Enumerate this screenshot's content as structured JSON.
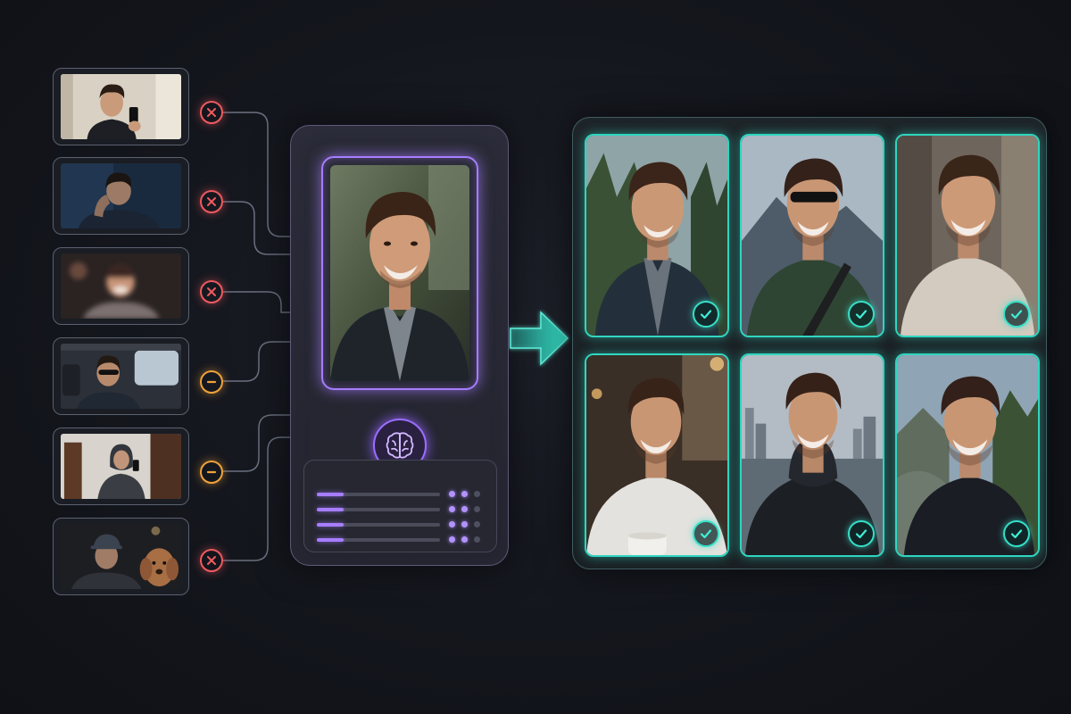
{
  "inputs": [
    {
      "scene": "mirror-selfie-indoor",
      "status": "rejected",
      "icon": "x-circle-icon"
    },
    {
      "scene": "dark-room-hand-on-face",
      "status": "rejected",
      "icon": "x-circle-icon"
    },
    {
      "scene": "blurry-low-light",
      "status": "rejected",
      "icon": "x-circle-icon"
    },
    {
      "scene": "car-sunglasses",
      "status": "neutral",
      "icon": "minus-circle-icon"
    },
    {
      "scene": "mirror-selfie-hoodie",
      "status": "neutral",
      "icon": "minus-circle-icon"
    },
    {
      "scene": "cap-with-dog",
      "status": "rejected",
      "icon": "x-circle-icon"
    }
  ],
  "processor": {
    "preview": "selected-portrait-smiling",
    "icon": "brain-icon",
    "metrics": [
      {
        "level": 0.22,
        "dots_on": 2
      },
      {
        "level": 0.22,
        "dots_on": 2
      },
      {
        "level": 0.22,
        "dots_on": 2
      },
      {
        "level": 0.22,
        "dots_on": 2
      }
    ]
  },
  "arrow_icon": "arrow-right-icon",
  "results": [
    {
      "scene": "forest-jacket",
      "icon": "check-circle-icon"
    },
    {
      "scene": "mountain-sunglasses",
      "icon": "check-circle-icon"
    },
    {
      "scene": "indoor-sweater",
      "icon": "check-circle-icon"
    },
    {
      "scene": "cafe-coffee",
      "icon": "check-circle-icon"
    },
    {
      "scene": "city-hoodie",
      "icon": "check-circle-icon"
    },
    {
      "scene": "nature-tee",
      "icon": "check-circle-icon"
    }
  ],
  "colors": {
    "rejected": "#ef5a5f",
    "neutral": "#f1a33a",
    "accent_purple": "#a77dff",
    "accent_teal": "#2fd6c0"
  }
}
